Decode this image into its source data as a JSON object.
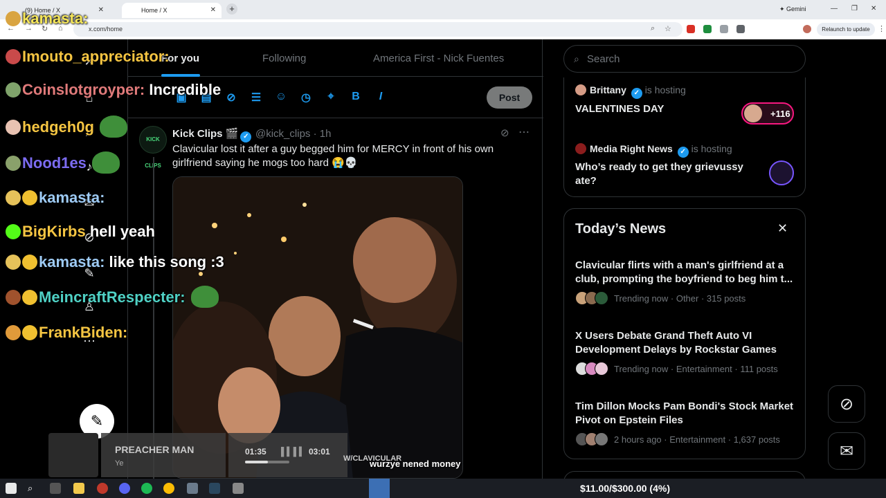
{
  "browser": {
    "tabs": [
      {
        "label": "(9) Home / X"
      },
      {
        "label": "Home / X"
      }
    ],
    "url": "x.com/home",
    "gemini_label": "Gemini",
    "relaunch_label": "Relaunch to update"
  },
  "timeline_tabs": [
    {
      "label": "For you"
    },
    {
      "label": "Following"
    },
    {
      "label": "America First - Nick Fuentes"
    }
  ],
  "composer": {
    "post_label": "Post",
    "bold_label": "B",
    "italic_label": "I"
  },
  "tweet": {
    "author": "Kick Clips 🎬",
    "handle": "@kick_clips · 1h",
    "text": "Clavicular lost it after a guy begged him for MERCY in front of his own girlfriend saying he mogs too hard 😭💀",
    "avatar_text": "KICK CLIPS"
  },
  "search": {
    "placeholder": "Search"
  },
  "spaces": [
    {
      "host": "Brittany",
      "status": "is hosting",
      "title": "VALENTINES DAY",
      "listeners": "+116"
    },
    {
      "host": "Media Right News",
      "status": "is hosting",
      "title": "Who’s ready to get they grievussy ate?"
    }
  ],
  "news": {
    "heading": "Today’s News",
    "items": [
      {
        "title": "Clavicular flirts with a man's girlfriend at a club, prompting the boyfriend to beg him t...",
        "meta": "Trending now · Other · 315 posts"
      },
      {
        "title": "X Users Debate Grand Theft Auto VI Development Delays by Rockstar Games",
        "meta": "Trending now · Entertainment · 111 posts"
      },
      {
        "title": "Tim Dillon Mocks Pam Bondi's Stock Market Pivot on Epstein Files",
        "meta": "2 hours ago · Entertainment · 1,637 posts"
      }
    ]
  },
  "chat": [
    {
      "user": "kamasta:",
      "msg": "",
      "color": "#f5e65a"
    },
    {
      "user": "Imouto_appreciator:",
      "msg": "",
      "color": "#f5c542"
    },
    {
      "user": "Coinslotgroyper:",
      "msg": "Incredible",
      "color": "#e07a7a"
    },
    {
      "user": "hedgeh0g",
      "msg": "",
      "color": "#f5c542"
    },
    {
      "user": "Nood1es",
      "msg": "",
      "color": "#7c6cf2"
    },
    {
      "user": "kamasta:",
      "msg": "",
      "color": "#9ecbf5"
    },
    {
      "user": "BigKirbs",
      "msg": "hell yeah",
      "color": "#f5c542"
    },
    {
      "user": "kamasta:",
      "msg": "like this song :3",
      "color": "#9ecbf5"
    },
    {
      "user": "MeincraftRespecter:",
      "msg": "",
      "color": "#4fd1c5"
    },
    {
      "user": "FrankBiden:",
      "msg": "",
      "color": "#f5c542"
    }
  ],
  "now_playing": {
    "song": "PREACHER MAN",
    "artist": "Ye",
    "elapsed": "01:35",
    "total": "03:01",
    "progress": 0.52
  },
  "overlay": {
    "subtitle": "wurzye nened money",
    "watermark": "W/CLAVICULAR"
  },
  "taskbar": {
    "donation": "$11.00/$300.00 (4%)"
  },
  "colors": {
    "accent": "#1d9bf0",
    "live": "#f91880",
    "background": "#000000"
  }
}
